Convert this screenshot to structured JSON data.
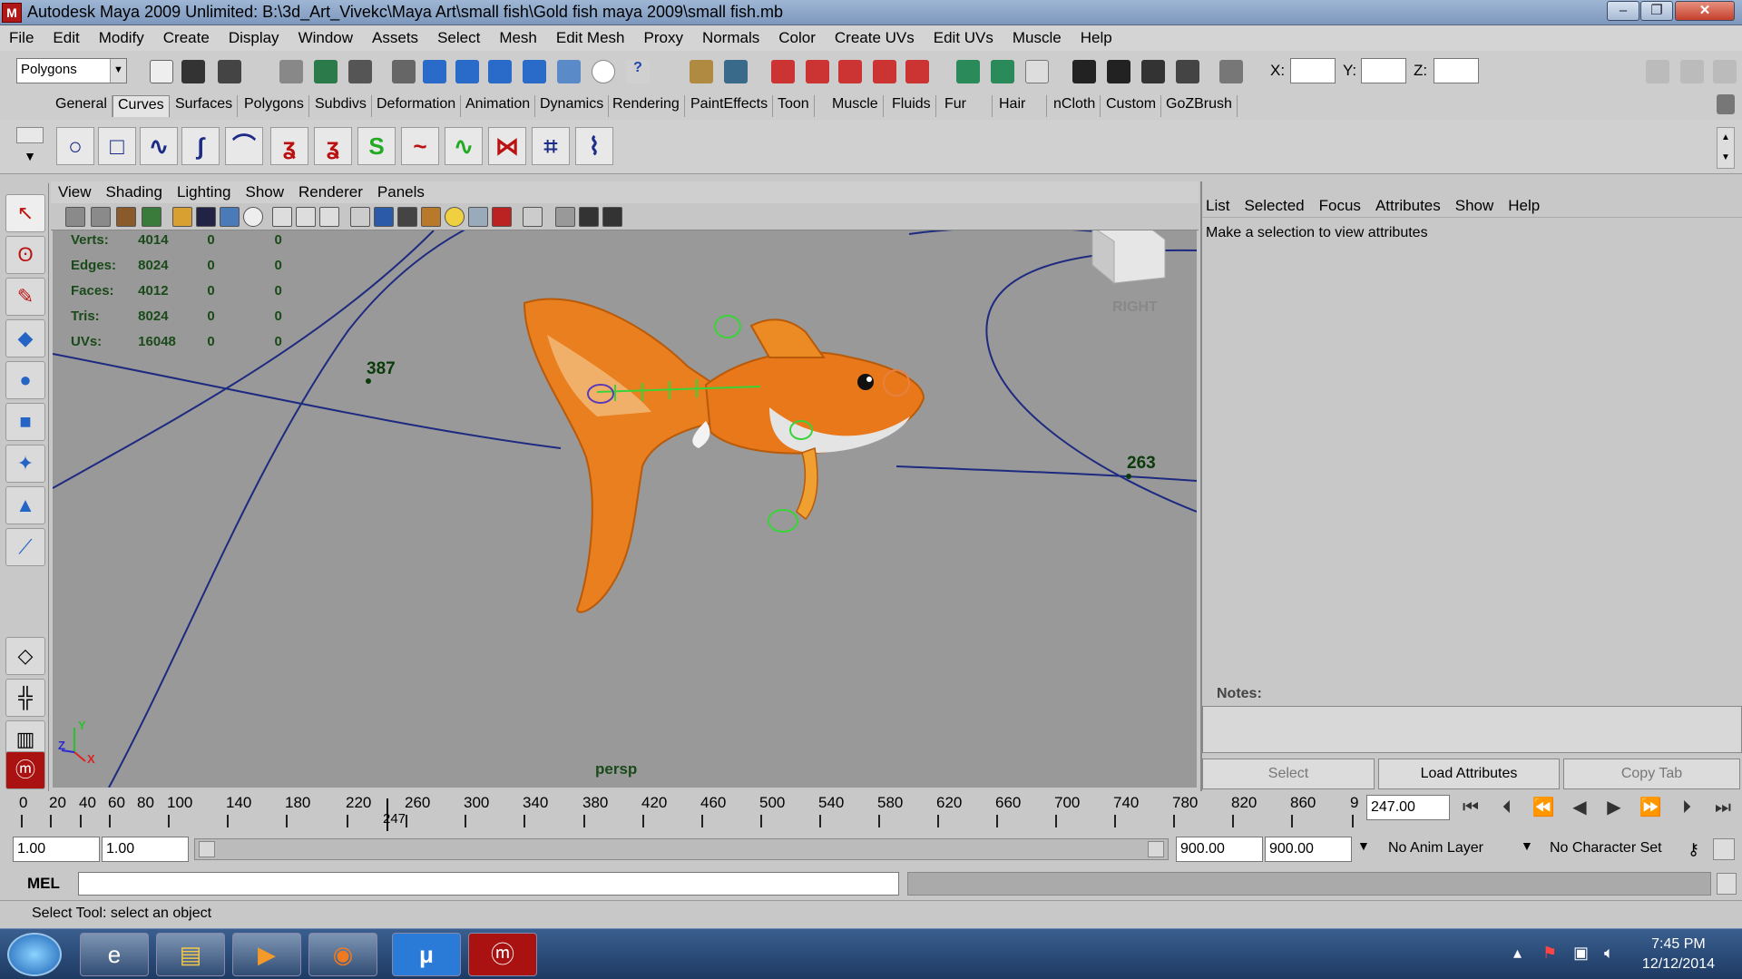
{
  "window": {
    "title": "Autodesk Maya 2009 Unlimited: B:\\3d_Art_Vivekc\\Maya Art\\small fish\\Gold fish maya 2009\\small fish.mb"
  },
  "menu": [
    "File",
    "Edit",
    "Modify",
    "Create",
    "Display",
    "Window",
    "Assets",
    "Select",
    "Mesh",
    "Edit Mesh",
    "Proxy",
    "Normals",
    "Color",
    "Create UVs",
    "Edit UVs",
    "Muscle",
    "Help"
  ],
  "toolbar": {
    "mode": "Polygons",
    "x_label": "X:",
    "y_label": "Y:",
    "z_label": "Z:"
  },
  "shelf_tabs": [
    "General",
    "Curves",
    "Surfaces",
    "Polygons",
    "Subdivs",
    "Deformation",
    "Animation",
    "Dynamics",
    "Rendering",
    "PaintEffects",
    "Toon",
    "Muscle",
    "Fluids",
    "Fur",
    "Hair",
    "nCloth",
    "Custom",
    "GoZBrush"
  ],
  "active_shelf_tab": "Curves",
  "viewport": {
    "menu": [
      "View",
      "Shading",
      "Lighting",
      "Show",
      "Renderer",
      "Panels"
    ],
    "hud": [
      {
        "label": "Verts:",
        "v1": "4014",
        "v2": "0",
        "v3": "0"
      },
      {
        "label": "Edges:",
        "v1": "8024",
        "v2": "0",
        "v3": "0"
      },
      {
        "label": "Faces:",
        "v1": "4012",
        "v2": "0",
        "v3": "0"
      },
      {
        "label": "Tris:",
        "v1": "8024",
        "v2": "0",
        "v3": "0"
      },
      {
        "label": "UVs:",
        "v1": "16048",
        "v2": "0",
        "v3": "0"
      }
    ],
    "curve_label_1": "387",
    "curve_label_2": "263",
    "view_cube_label": "RIGHT",
    "camera_label": "persp",
    "axis_z": "Z",
    "axis_y": "Y",
    "axis_x": "X"
  },
  "attribute_editor": {
    "menu": [
      "List",
      "Selected",
      "Focus",
      "Attributes",
      "Show",
      "Help"
    ],
    "message": "Make a selection to view attributes",
    "notes_label": "Notes:",
    "select_button": "Select",
    "load_button": "Load Attributes",
    "copy_button": "Copy Tab"
  },
  "time_slider": {
    "ticks": [
      "0",
      "20",
      "40",
      "60",
      "80",
      "100",
      "140",
      "180",
      "220",
      "260",
      "300",
      "340",
      "380",
      "420",
      "460",
      "500",
      "540",
      "580",
      "620",
      "660",
      "700",
      "740",
      "780",
      "820",
      "860",
      "9"
    ],
    "current_marker": "247",
    "current_frame": "247.00"
  },
  "range": {
    "start": "1.00",
    "start2": "1.00",
    "end": "900.00",
    "end2": "900.00",
    "anim_layer": "No Anim Layer",
    "character_set": "No Character Set"
  },
  "mel": {
    "label": "MEL"
  },
  "help_line": "Select Tool: select an object",
  "taskbar": {
    "time": "7:45 PM",
    "date": "12/12/2014"
  }
}
